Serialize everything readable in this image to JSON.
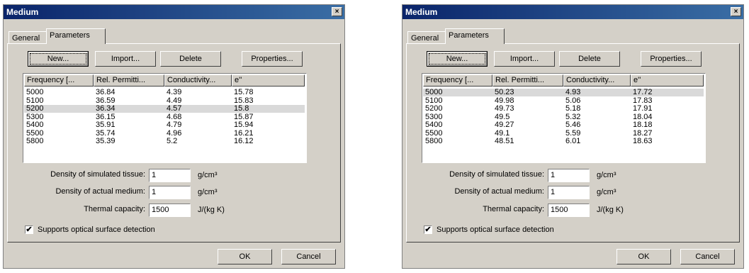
{
  "dialogs": [
    {
      "title": "Medium",
      "close_glyph": "×",
      "tabs": [
        "General",
        "Parameters"
      ],
      "buttons": {
        "new": "New...",
        "import": "Import...",
        "delete": "Delete",
        "properties": "Properties...",
        "ok": "OK",
        "cancel": "Cancel"
      },
      "columns": [
        "Frequency [...",
        "Rel. Permitti...",
        "Conductivity...",
        "e''"
      ],
      "rows": [
        [
          "5000",
          "36.84",
          "4.39",
          "15.78"
        ],
        [
          "5100",
          "36.59",
          "4.49",
          "15.83"
        ],
        [
          "5200",
          "36.34",
          "4.57",
          "15.8"
        ],
        [
          "5300",
          "36.15",
          "4.68",
          "15.87"
        ],
        [
          "5400",
          "35.91",
          "4.79",
          "15.94"
        ],
        [
          "5500",
          "35.74",
          "4.96",
          "16.21"
        ],
        [
          "5800",
          "35.39",
          "5.2",
          "16.12"
        ]
      ],
      "selected_row": 2,
      "fields": [
        {
          "label": "Density of simulated tissue:",
          "value": "1",
          "unit": "g/cm³"
        },
        {
          "label": "Density of actual medium:",
          "value": "1",
          "unit": "g/cm³"
        },
        {
          "label": "Thermal capacity:",
          "value": "1500",
          "unit": "J/(kg K)"
        }
      ],
      "checkbox": {
        "label": "Supports optical surface detection",
        "checked": true,
        "glyph": "✔"
      }
    },
    {
      "title": "Medium",
      "close_glyph": "×",
      "tabs": [
        "General",
        "Parameters"
      ],
      "buttons": {
        "new": "New...",
        "import": "Import...",
        "delete": "Delete",
        "properties": "Properties...",
        "ok": "OK",
        "cancel": "Cancel"
      },
      "columns": [
        "Frequency [...",
        "Rel. Permitti...",
        "Conductivity...",
        "e''"
      ],
      "rows": [
        [
          "5000",
          "50.23",
          "4.93",
          "17.72"
        ],
        [
          "5100",
          "49.98",
          "5.06",
          "17.83"
        ],
        [
          "5200",
          "49.73",
          "5.18",
          "17.91"
        ],
        [
          "5300",
          "49.5",
          "5.32",
          "18.04"
        ],
        [
          "5400",
          "49.27",
          "5.46",
          "18.18"
        ],
        [
          "5500",
          "49.1",
          "5.59",
          "18.27"
        ],
        [
          "5800",
          "48.51",
          "6.01",
          "18.63"
        ]
      ],
      "selected_row": 0,
      "fields": [
        {
          "label": "Density of simulated tissue:",
          "value": "1",
          "unit": "g/cm³"
        },
        {
          "label": "Density of actual medium:",
          "value": "1",
          "unit": "g/cm³"
        },
        {
          "label": "Thermal capacity:",
          "value": "1500",
          "unit": "J/(kg K)"
        }
      ],
      "checkbox": {
        "label": "Supports optical surface detection",
        "checked": true,
        "glyph": "✔"
      }
    }
  ]
}
